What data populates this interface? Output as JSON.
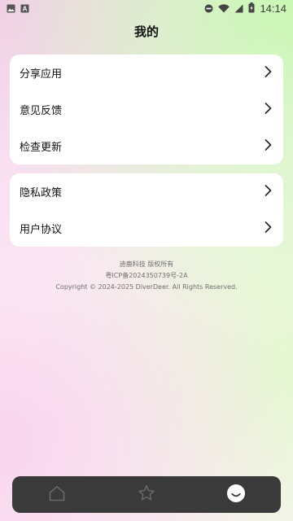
{
  "status_bar": {
    "time": "14:14",
    "battery_level": "62",
    "icons": [
      "image-icon",
      "a-notification-icon",
      "dnd-icon",
      "wifi-icon",
      "signal-icon",
      "battery-icon"
    ]
  },
  "header": {
    "title": "我的"
  },
  "menu": {
    "group1": [
      {
        "label": "分享应用",
        "icon": "chevron-right-icon"
      },
      {
        "label": "意见反馈",
        "icon": "chevron-right-icon"
      },
      {
        "label": "检查更新",
        "icon": "chevron-right-icon"
      }
    ],
    "group2": [
      {
        "label": "隐私政策",
        "icon": "chevron-right-icon"
      },
      {
        "label": "用户协议",
        "icon": "chevron-right-icon"
      }
    ]
  },
  "footer": {
    "company": "迪鹿科技 版权所有",
    "icp": "粤ICP备2024350739号-2A",
    "copyright": "Copyright © 2024-2025 DiverDeer. All Rights Reserved."
  },
  "tab_bar": {
    "tabs": [
      {
        "icon": "home-icon",
        "active": false
      },
      {
        "icon": "star-icon",
        "active": false
      },
      {
        "icon": "smile-icon",
        "active": true
      }
    ]
  },
  "colors": {
    "card_bg": "#ffffff",
    "tab_bar_bg": "#3a3a3a",
    "tab_icon_inactive": "#6a6a6a",
    "tab_icon_active": "#ffffff"
  }
}
